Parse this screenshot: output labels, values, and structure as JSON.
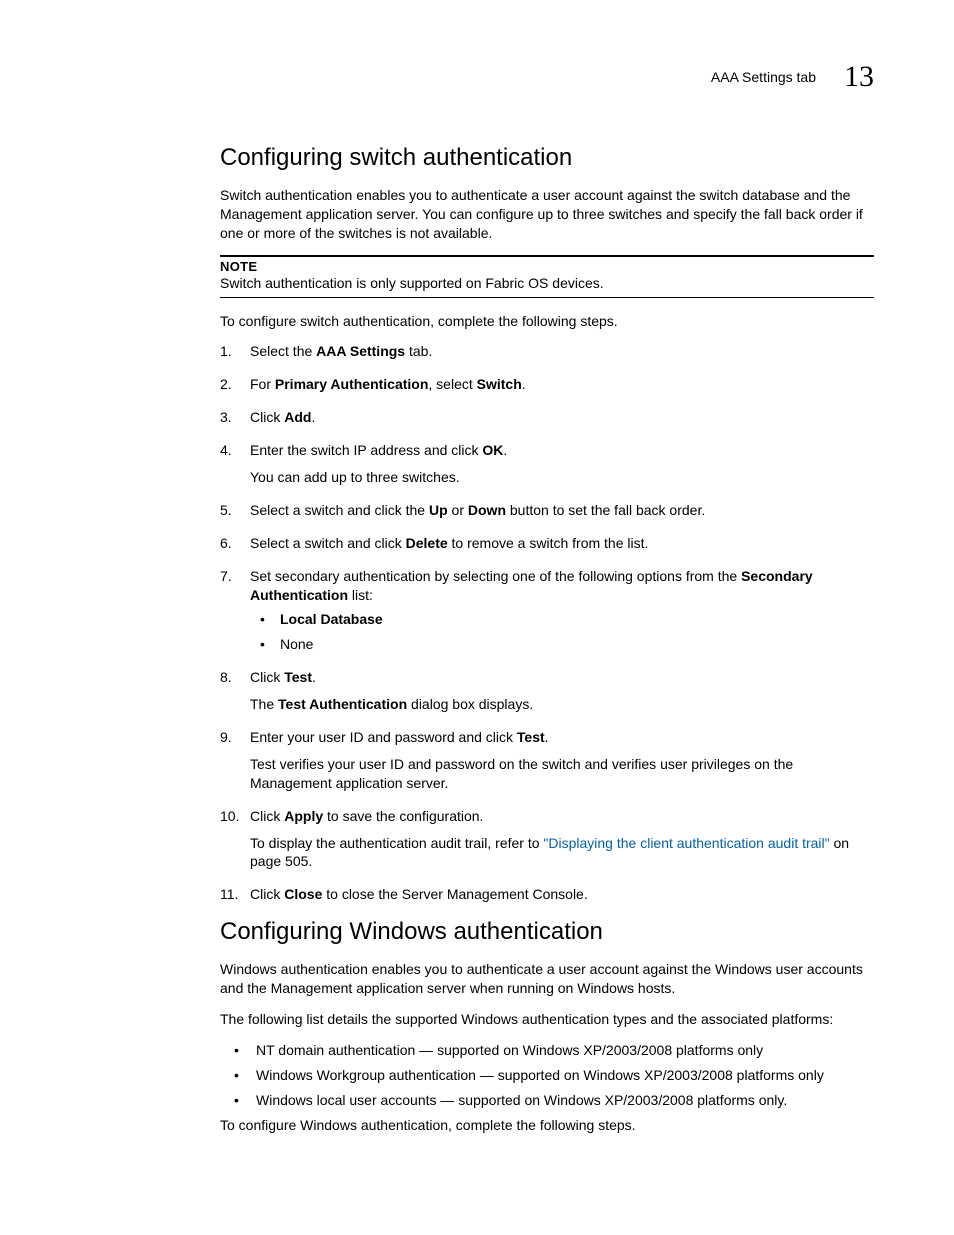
{
  "header": {
    "label": "AAA Settings tab",
    "chapter": "13"
  },
  "section1": {
    "title": "Configuring switch authentication",
    "intro": "Switch authentication enables you to authenticate a user account against the switch database and the Management application server. You can configure up to three switches and specify the fall back order if one or more of the switches is not available.",
    "noteLabel": "NOTE",
    "noteText": "Switch authentication is only supported on Fabric OS devices.",
    "lead": "To configure switch authentication, complete the following steps.",
    "steps": {
      "s1_a": "Select the ",
      "s1_b": "AAA Settings",
      "s1_c": " tab.",
      "s2_a": "For ",
      "s2_b": "Primary Authentication",
      "s2_c": ", select ",
      "s2_d": "Switch",
      "s2_e": ".",
      "s3_a": "Click ",
      "s3_b": "Add",
      "s3_c": ".",
      "s4_a": "Enter the switch IP address and click ",
      "s4_b": "OK",
      "s4_c": ".",
      "s4_note": "You can add up to three switches.",
      "s5_a": "Select a switch and click the ",
      "s5_b": "Up",
      "s5_c": " or ",
      "s5_d": "Down",
      "s5_e": " button to set the fall back order.",
      "s6_a": "Select a switch and click ",
      "s6_b": "Delete",
      "s6_c": " to remove a switch from the list.",
      "s7_a": "Set secondary authentication by selecting one of the following options from the ",
      "s7_b": "Secondary Authentication",
      "s7_c": " list:",
      "s7_opt1": "Local Database",
      "s7_opt2": "None",
      "s8_a": "Click ",
      "s8_b": "Test",
      "s8_c": ".",
      "s8_note_a": "The ",
      "s8_note_b": "Test Authentication",
      "s8_note_c": " dialog box displays.",
      "s9_a": "Enter your user ID and password and click ",
      "s9_b": "Test",
      "s9_c": ".",
      "s9_note": "Test verifies your user ID and password on the switch and verifies user privileges on the Management application server.",
      "s10_a": "Click ",
      "s10_b": "Apply",
      "s10_c": " to save the configuration.",
      "s10_note_a": "To display the authentication audit trail, refer to ",
      "s10_link": "\"Displaying the client authentication audit trail\"",
      "s10_note_b": " on page 505.",
      "s11_a": "Click ",
      "s11_b": "Close",
      "s11_c": " to close the Server Management Console."
    }
  },
  "section2": {
    "title": "Configuring Windows authentication",
    "p1": "Windows authentication enables you to authenticate a user account against the Windows user accounts and the Management application server when running on Windows hosts.",
    "p2": "The following list details the supported Windows authentication types and the associated platforms:",
    "b1": "NT domain authentication — supported on Windows XP/2003/2008 platforms only",
    "b2": "Windows Workgroup authentication — supported on Windows XP/2003/2008 platforms only",
    "b3": "Windows local user accounts — supported on Windows XP/2003/2008 platforms only.",
    "lead": "To configure Windows authentication, complete the following steps."
  }
}
